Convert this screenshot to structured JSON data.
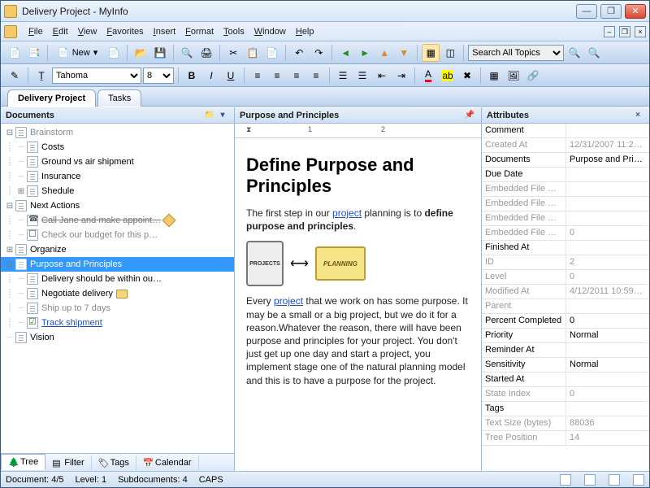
{
  "window": {
    "title": "Delivery Project - MyInfo"
  },
  "menu": [
    "File",
    "Edit",
    "View",
    "Favorites",
    "Insert",
    "Format",
    "Tools",
    "Window",
    "Help"
  ],
  "toolbar": {
    "new_label": "New",
    "search_option": "Search All Topics"
  },
  "format": {
    "font": "Tahoma",
    "size": "8"
  },
  "doc_tabs": [
    {
      "label": "Delivery Project",
      "active": true
    },
    {
      "label": "Tasks",
      "active": false
    }
  ],
  "left": {
    "header": "Documents",
    "tree": [
      {
        "d": 0,
        "exp": "-",
        "label": "Brainstorm",
        "cls": "dim"
      },
      {
        "d": 1,
        "label": "Costs"
      },
      {
        "d": 1,
        "label": "Ground vs air shipment"
      },
      {
        "d": 1,
        "label": "Insurance"
      },
      {
        "d": 1,
        "exp": "+",
        "label": "Shedule"
      },
      {
        "d": 0,
        "exp": "-",
        "label": "Next Actions"
      },
      {
        "d": 1,
        "icon": "phone",
        "label": "Call Jane and make appoint…",
        "cls": "done",
        "tag": true
      },
      {
        "d": 1,
        "icon": "check",
        "label": "Check our budget for this p…",
        "cls": "dim"
      },
      {
        "d": 0,
        "exp": "+",
        "label": "Organize"
      },
      {
        "d": 0,
        "exp": "-",
        "label": "Purpose and Principles",
        "selected": true
      },
      {
        "d": 1,
        "label": "Delivery should be within ou…"
      },
      {
        "d": 1,
        "label": "Negotiate delivery",
        "folder": true
      },
      {
        "d": 1,
        "label": "Ship up to 7 days",
        "cls": "dim"
      },
      {
        "d": 1,
        "icon": "checkd",
        "label": "Track shipment",
        "cls": "link"
      },
      {
        "d": 0,
        "label": "Vision"
      }
    ],
    "bottom_tabs": [
      {
        "label": "Tree",
        "active": true
      },
      {
        "label": "Filter"
      },
      {
        "label": "Tags"
      },
      {
        "label": "Calendar"
      }
    ]
  },
  "center": {
    "header": "Purpose and Principles",
    "heading": "Define Purpose and Principles",
    "p1a": "The first step in our ",
    "p1link": "project",
    "p1b": " planning is to ",
    "p1c": "define purpose and principles",
    "img_left": "PROJECTS",
    "img_right": "PLANNING",
    "p2a": "Every ",
    "p2link": "project",
    "p2b": " that we work on has some purpose. It may be a small or a big project, but we do it for a reason.Whatever the reason, there will have been purpose and principles for your project. You don't just get up one day and start a project, you implement stage one of the natural planning model and this is to have a purpose for the project."
  },
  "right": {
    "header": "Attributes",
    "rows": [
      {
        "k": "Comment",
        "v": ""
      },
      {
        "k": "Created At",
        "v": "12/31/2007 11:2…",
        "dim": true
      },
      {
        "k": "Documents",
        "v": "Purpose and Prin…"
      },
      {
        "k": "Due Date",
        "v": ""
      },
      {
        "k": "Embedded File C…",
        "v": "",
        "dim": true
      },
      {
        "k": "Embedded File M…",
        "v": "",
        "dim": true
      },
      {
        "k": "Embedded File N…",
        "v": "",
        "dim": true
      },
      {
        "k": "Embedded File Si…",
        "v": "0",
        "dim": true
      },
      {
        "k": "Finished At",
        "v": ""
      },
      {
        "k": "ID",
        "v": "2",
        "dim": true
      },
      {
        "k": "Level",
        "v": "0",
        "dim": true
      },
      {
        "k": "Modified At",
        "v": "4/12/2011 10:59…",
        "dim": true
      },
      {
        "k": "Parent",
        "v": "",
        "dim": true
      },
      {
        "k": "Percent Completed",
        "v": "0"
      },
      {
        "k": "Priority",
        "v": "Normal"
      },
      {
        "k": "Reminder At",
        "v": ""
      },
      {
        "k": "Sensitivity",
        "v": "Normal"
      },
      {
        "k": "Started At",
        "v": ""
      },
      {
        "k": "State Index",
        "v": "0",
        "dim": true
      },
      {
        "k": "Tags",
        "v": ""
      },
      {
        "k": "Text Size (bytes)",
        "v": "88036",
        "dim": true
      },
      {
        "k": "Tree Position",
        "v": "14",
        "dim": true
      }
    ]
  },
  "status": {
    "doc": "Document: 4/5",
    "level": "Level: 1",
    "sub": "Subdocuments: 4",
    "caps": "CAPS"
  }
}
